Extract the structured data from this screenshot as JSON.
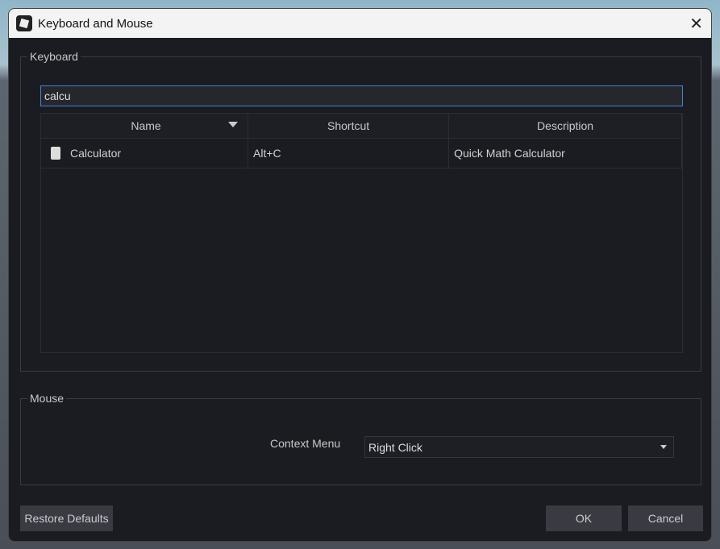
{
  "window": {
    "title": "Keyboard and Mouse"
  },
  "keyboard": {
    "legend": "Keyboard",
    "search_value": "calcu",
    "columns": [
      "Name",
      "Shortcut",
      "Description"
    ],
    "rows": [
      {
        "name": "Calculator",
        "shortcut": "Alt+C",
        "description": "Quick Math Calculator"
      }
    ]
  },
  "mouse": {
    "legend": "Mouse",
    "context_menu_label": "Context Menu",
    "context_menu_value": "Right Click"
  },
  "buttons": {
    "restore": "Restore Defaults",
    "ok": "OK",
    "cancel": "Cancel"
  }
}
